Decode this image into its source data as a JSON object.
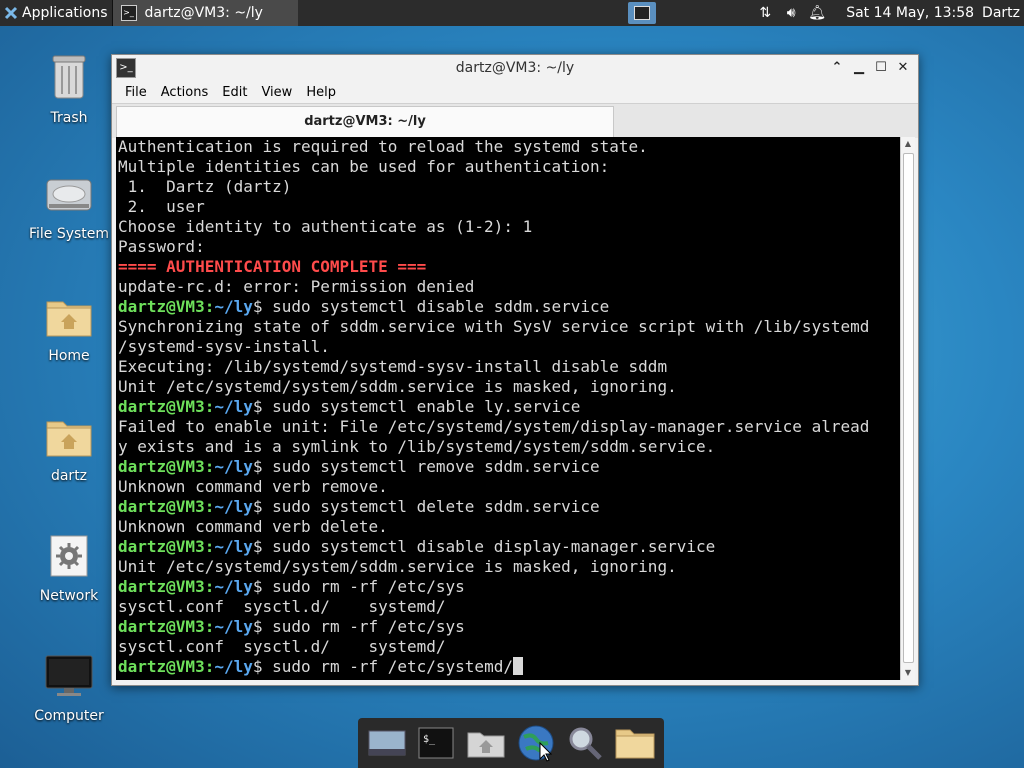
{
  "panel": {
    "applications_label": "Applications",
    "task_title": "dartz@VM3: ~/ly",
    "clock": "Sat 14 May, 13:58",
    "user": "Dartz"
  },
  "desktop_icons": [
    {
      "label": "Trash"
    },
    {
      "label": "File System"
    },
    {
      "label": "Home"
    },
    {
      "label": "dartz"
    },
    {
      "label": "Network"
    },
    {
      "label": "Computer"
    }
  ],
  "window": {
    "title": "dartz@VM3: ~/ly",
    "menus": [
      "File",
      "Actions",
      "Edit",
      "View",
      "Help"
    ],
    "tab_label": "dartz@VM3: ~/ly"
  },
  "terminal": {
    "prompt_user": "dartz@VM3",
    "prompt_path": "~/ly",
    "lines": [
      {
        "t": "Authentication is required to reload the systemd state."
      },
      {
        "t": "Multiple identities can be used for authentication:"
      },
      {
        "t": " 1.  Dartz (dartz)"
      },
      {
        "t": " 2.  user"
      },
      {
        "t": "Choose identity to authenticate as (1-2): 1"
      },
      {
        "t": "Password: "
      },
      {
        "t": "==== AUTHENTICATION COMPLETE ===",
        "style": "red"
      },
      {
        "t": "update-rc.d: error: Permission denied"
      },
      {
        "cmd": "sudo systemctl disable sddm.service"
      },
      {
        "t": "Synchronizing state of sddm.service with SysV service script with /lib/systemd"
      },
      {
        "t": "/systemd-sysv-install."
      },
      {
        "t": "Executing: /lib/systemd/systemd-sysv-install disable sddm"
      },
      {
        "t": "Unit /etc/systemd/system/sddm.service is masked, ignoring."
      },
      {
        "cmd": "sudo systemctl enable ly.service"
      },
      {
        "t": "Failed to enable unit: File /etc/systemd/system/display-manager.service alread"
      },
      {
        "t": "y exists and is a symlink to /lib/systemd/system/sddm.service."
      },
      {
        "cmd": "sudo systemctl remove sddm.service"
      },
      {
        "t": "Unknown command verb remove."
      },
      {
        "cmd": "sudo systemctl delete sddm.service"
      },
      {
        "t": "Unknown command verb delete."
      },
      {
        "cmd": "sudo systemctl disable display-manager.service"
      },
      {
        "t": "Unit /etc/systemd/system/sddm.service is masked, ignoring."
      },
      {
        "cmd": "sudo rm -rf /etc/sys"
      },
      {
        "t": "sysctl.conf  sysctl.d/    systemd/"
      },
      {
        "cmd": "sudo rm -rf /etc/sys"
      },
      {
        "t": "sysctl.conf  sysctl.d/    systemd/"
      },
      {
        "cmd": "sudo rm -rf /etc/systemd/",
        "cursor": true
      }
    ]
  },
  "colors": {
    "prompt_user": "#6ee05b",
    "prompt_path": "#5aa8f0",
    "auth_complete": "#ff4b4b",
    "terminal_bg": "#000000"
  },
  "dock_items": [
    "show-desktop-icon",
    "terminal-icon",
    "file-manager-icon",
    "web-browser-icon",
    "app-finder-icon",
    "folder-icon"
  ]
}
